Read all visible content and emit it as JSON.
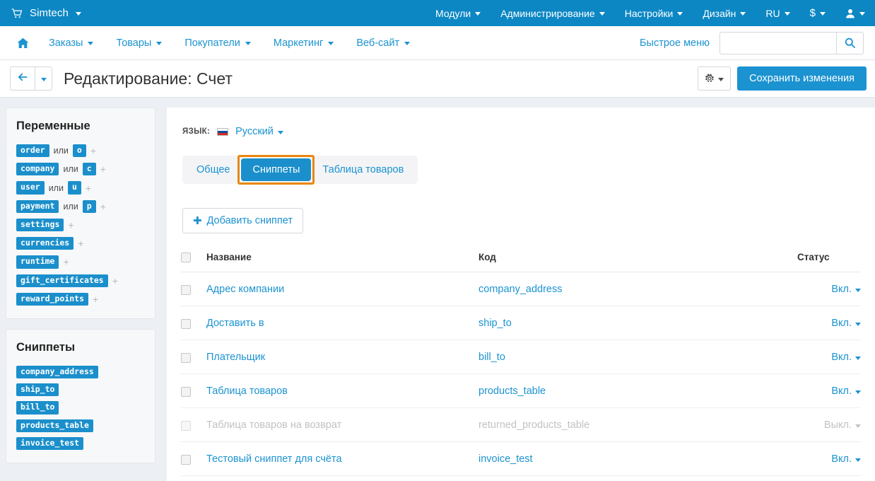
{
  "topbar": {
    "brand": "Simtech",
    "cart_icon": "cart-icon",
    "menu": [
      {
        "label": "Модули",
        "icon": "chevron-down-icon"
      },
      {
        "label": "Администрирование",
        "icon": "chevron-down-icon"
      },
      {
        "label": "Настройки",
        "icon": "chevron-down-icon"
      },
      {
        "label": "Дизайн",
        "icon": "chevron-down-icon"
      },
      {
        "label": "RU",
        "icon": "chevron-down-icon"
      }
    ],
    "currency": "$",
    "user_icon": "user-icon"
  },
  "navbar": {
    "home_icon": "home-icon",
    "items": [
      {
        "label": "Заказы"
      },
      {
        "label": "Товары"
      },
      {
        "label": "Покупатели"
      },
      {
        "label": "Маркетинг"
      },
      {
        "label": "Веб-сайт"
      }
    ],
    "quick_menu": "Быстрое меню",
    "search_value": "",
    "search_placeholder": "",
    "search_icon": "search-icon"
  },
  "titlebar": {
    "back_icon": "arrow-left-icon",
    "back_caret_icon": "chevron-down-icon",
    "title": "Редактирование: Счет",
    "gear_icon": "gear-icon",
    "gear_caret_icon": "chevron-down-icon",
    "save_label": "Сохранить изменения"
  },
  "sidebar": {
    "variables_panel": {
      "title": "Переменные",
      "or_word": "или",
      "plus_icon": "plus-icon",
      "items": [
        {
          "name": "order",
          "alias": "o"
        },
        {
          "name": "company",
          "alias": "c"
        },
        {
          "name": "user",
          "alias": "u"
        },
        {
          "name": "payment",
          "alias": "p"
        },
        {
          "name": "settings",
          "alias": ""
        },
        {
          "name": "currencies",
          "alias": ""
        },
        {
          "name": "runtime",
          "alias": ""
        },
        {
          "name": "gift_certificates",
          "alias": ""
        },
        {
          "name": "reward_points",
          "alias": ""
        }
      ]
    },
    "snippets_panel": {
      "title": "Сниппеты",
      "items": [
        "company_address",
        "ship_to",
        "bill_to",
        "products_table",
        "invoice_test"
      ]
    }
  },
  "main": {
    "lang_label": "ЯЗЫК:",
    "lang_flag": "flag-ru-icon",
    "lang_value": "Русский",
    "tabs": [
      {
        "label": "Общее",
        "active": false
      },
      {
        "label": "Сниппеты",
        "active": true
      },
      {
        "label": "Таблица товаров",
        "active": false
      }
    ],
    "highlighted_tab_index": 1,
    "highlight_color": "#e8880f",
    "add_button": {
      "icon": "plus-icon",
      "label": "Добавить сниппет"
    },
    "table": {
      "headers": {
        "select_all": "select-all-checkbox",
        "name": "Название",
        "code": "Код",
        "status": "Статус"
      },
      "rows": [
        {
          "name": "Адрес компании",
          "code": "company_address",
          "status": "Вкл.",
          "enabled": true
        },
        {
          "name": "Доставить в",
          "code": "ship_to",
          "status": "Вкл.",
          "enabled": true
        },
        {
          "name": "Плательщик",
          "code": "bill_to",
          "status": "Вкл.",
          "enabled": true
        },
        {
          "name": "Таблица товаров",
          "code": "products_table",
          "status": "Вкл.",
          "enabled": true
        },
        {
          "name": "Таблица товаров на возврат",
          "code": "returned_products_table",
          "status": "Выкл.",
          "enabled": false
        },
        {
          "name": "Тестовый сниппет для счёта",
          "code": "invoice_test",
          "status": "Вкл.",
          "enabled": true
        }
      ]
    }
  },
  "colors": {
    "brand_blue": "#0c87c4",
    "link_blue": "#1b93d1",
    "tag_blue": "#1b8fcb",
    "highlight_orange": "#e8880f",
    "page_bg": "#eceff3"
  }
}
